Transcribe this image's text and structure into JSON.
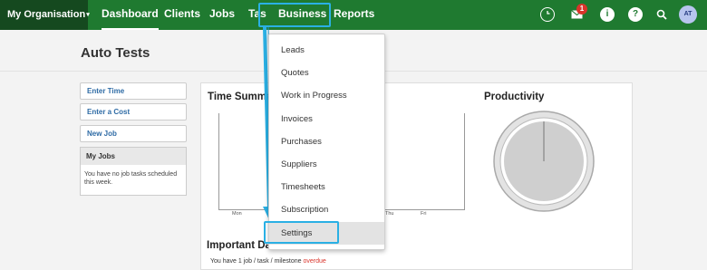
{
  "org": {
    "name": "My Organisation",
    "caret": "▾"
  },
  "nav": {
    "dashboard": "Dashboard",
    "clients": "Clients",
    "jobs": "Jobs",
    "tasks_partial": "Tas",
    "business": "Business",
    "reports": "Reports"
  },
  "notifications": {
    "count": "1"
  },
  "user": {
    "initials": "AT"
  },
  "page": {
    "title": "Auto Tests"
  },
  "sidebar": {
    "enter_time": "Enter Time",
    "enter_cost": "Enter a Cost",
    "new_job": "New Job",
    "my_jobs": {
      "title": "My Jobs",
      "empty_text": "You have no job tasks scheduled this week."
    }
  },
  "time_summary": {
    "title": "Time Summa",
    "ticks": [
      "Mon",
      "Thu",
      "Fri"
    ]
  },
  "productivity": {
    "title": "Productivity"
  },
  "important": {
    "title": "Important Da",
    "summary_text": "You have 1 job / task / milestone ",
    "overdue_text": "overdue"
  },
  "business_menu": {
    "items": [
      "Leads",
      "Quotes",
      "Work in Progress",
      "Invoices",
      "Purchases",
      "Suppliers",
      "Timesheets",
      "Subscription",
      "Settings"
    ],
    "hovered": "Settings"
  },
  "colors": {
    "nav_bg": "#1f7a30",
    "org_bg": "#15491f",
    "highlight": "#2ab0e4",
    "link": "#2e6ba5",
    "overdue": "#d9342b"
  },
  "icons": [
    "clock-icon",
    "mail-icon",
    "info-icon",
    "help-icon",
    "search-icon",
    "chevron-down-icon"
  ]
}
